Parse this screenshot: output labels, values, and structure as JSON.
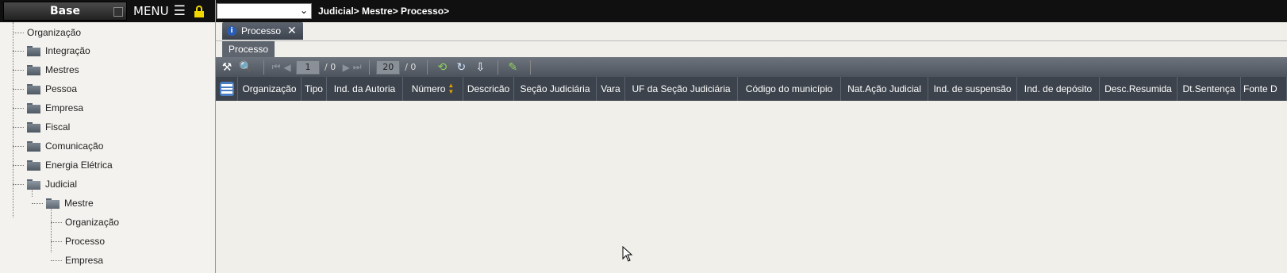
{
  "sidebar": {
    "title": "Base",
    "menu_label": "MENU",
    "tree": [
      {
        "label": "Organização"
      },
      {
        "label": "Integração"
      },
      {
        "label": "Mestres"
      },
      {
        "label": "Pessoa"
      },
      {
        "label": "Empresa"
      },
      {
        "label": "Fiscal"
      },
      {
        "label": "Comunicação"
      },
      {
        "label": "Energia Elétrica"
      },
      {
        "label": "Judicial"
      },
      {
        "label": "Mestre"
      },
      {
        "label": "Organização"
      },
      {
        "label": "Processo"
      },
      {
        "label": "Empresa"
      }
    ]
  },
  "topbar": {
    "organization_select_value": "",
    "breadcrumb": "Judicial> Mestre> Processo>"
  },
  "tabs": {
    "main_tab_label": "Processo",
    "sub_tab_label": "Processo"
  },
  "toolbar": {
    "page_current": "1",
    "page_total": "/ 0",
    "page_size": "20",
    "record_total": "/ 0"
  },
  "grid": {
    "columns": [
      "Organização",
      "Tipo",
      "Ind. da Autoria",
      "Número",
      "Descricão",
      "Seção Judiciária",
      "Vara",
      "UF da Seção Judiciária",
      "Código do município",
      "Nat.Ação Judicial",
      "Ind. de suspensão",
      "Ind. de depósito",
      "Desc.Resumida",
      "Dt.Sentença",
      "Fonte D"
    ],
    "rows": []
  },
  "colors": {
    "header_bg": "#101010",
    "lock_icon": "#f0d800",
    "grid_header_bg": "#3c434c",
    "body_bg": "#f0efea"
  }
}
